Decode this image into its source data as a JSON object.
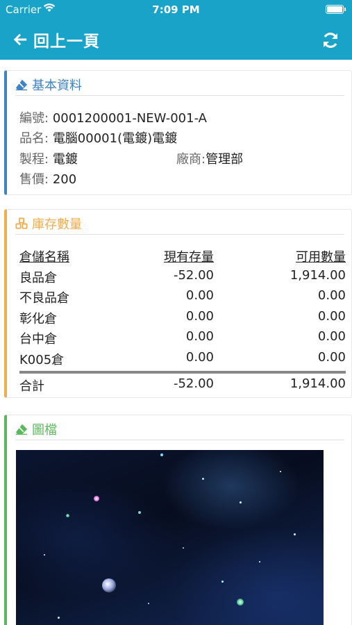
{
  "status_bar": {
    "carrier": "Carrier",
    "time": "7:09 PM"
  },
  "nav": {
    "back_label": "回上一頁",
    "back_icon": "arrow-left-icon",
    "refresh_icon": "refresh-icon"
  },
  "basic": {
    "title": "基本資料",
    "icon": "eraser-icon",
    "code_label": "編號:",
    "code_value": "0001200001-NEW-001-A",
    "name_label": "品名:",
    "name_value": "電腦00001(電鍍)電鍍",
    "process_label": "製程:",
    "process_value": "電鍍",
    "vendor_label": "廠商:",
    "vendor_value": "管理部",
    "price_label": "售價:",
    "price_value": "200"
  },
  "stock": {
    "title": "庫存數量",
    "icon": "cubes-icon",
    "headers": [
      "倉儲名稱",
      "現有存量",
      "可用數量"
    ],
    "rows": [
      {
        "name": "良品倉",
        "on_hand": "-52.00",
        "available": "1,914.00"
      },
      {
        "name": "不良品倉",
        "on_hand": "0.00",
        "available": "0.00"
      },
      {
        "name": "彰化倉",
        "on_hand": "0.00",
        "available": "0.00"
      },
      {
        "name": "台中倉",
        "on_hand": "0.00",
        "available": "0.00"
      },
      {
        "name": "K005倉",
        "on_hand": "0.00",
        "available": "0.00"
      }
    ],
    "total": {
      "name": "合計",
      "on_hand": "-52.00",
      "available": "1,914.00"
    }
  },
  "image": {
    "title": "圖檔",
    "icon": "eraser-icon"
  },
  "colors": {
    "nav": "#1aa3c9",
    "basic": "#3f82c5",
    "stock": "#f0ad4e",
    "image": "#5cb85c"
  }
}
